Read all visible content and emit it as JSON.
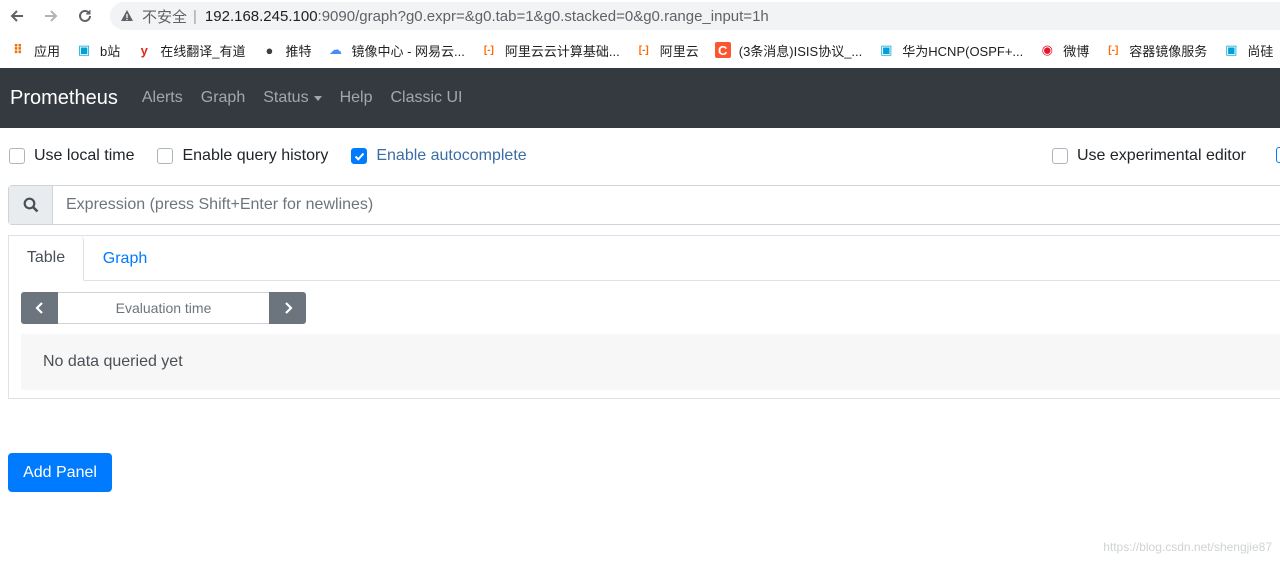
{
  "browser": {
    "insecure_label": "不安全",
    "separator": "|",
    "url_host": "192.168.245.100",
    "url_rest": ":9090/graph?g0.expr=&g0.tab=1&g0.stacked=0&g0.range_input=1h"
  },
  "bookmarks": [
    {
      "label": "应用",
      "icon": "apps-grid-icon",
      "color": "#e8710a"
    },
    {
      "label": "b站",
      "icon": "bilibili-icon",
      "color": "#00a1d6"
    },
    {
      "label": "在线翻译_有道",
      "icon": "youdao-icon",
      "color": "#e1251b"
    },
    {
      "label": "推特",
      "icon": "globe-icon",
      "color": "#3c4043"
    },
    {
      "label": "镜像中心 - 网易云...",
      "icon": "cloud-icon",
      "color": "#4c8bf5"
    },
    {
      "label": "阿里云云计算基础...",
      "icon": "aliyun-icon",
      "color": "#ff6a00"
    },
    {
      "label": "阿里云",
      "icon": "aliyun-icon",
      "color": "#ff6a00"
    },
    {
      "label": "(3条消息)ISIS协议_...",
      "icon": "csdn-icon",
      "color": "#fc5531"
    },
    {
      "label": "华为HCNP(OSPF+...",
      "icon": "bilibili-icon",
      "color": "#00a1d6"
    },
    {
      "label": "微博",
      "icon": "weibo-icon",
      "color": "#e6162d"
    },
    {
      "label": "容器镜像服务",
      "icon": "aliyun-icon",
      "color": "#ff6a00"
    },
    {
      "label": "尚硅",
      "icon": "bilibili-icon",
      "color": "#00a1d6"
    }
  ],
  "navbar": {
    "brand": "Prometheus",
    "links": {
      "alerts": "Alerts",
      "graph": "Graph",
      "status": "Status",
      "help": "Help",
      "classic": "Classic UI"
    }
  },
  "options": {
    "local_time": {
      "label": "Use local time",
      "checked": false
    },
    "query_history": {
      "label": "Enable query history",
      "checked": false
    },
    "autocomplete": {
      "label": "Enable autocomplete",
      "checked": true
    },
    "experimental_editor": {
      "label": "Use experimental editor",
      "checked": false
    }
  },
  "expression": {
    "placeholder": "Expression (press Shift+Enter for newlines)"
  },
  "panel": {
    "tabs": {
      "table": "Table",
      "graph": "Graph"
    },
    "eval_placeholder": "Evaluation time",
    "no_data": "No data queried yet"
  },
  "add_panel": "Add Panel",
  "watermark": "https://blog.csdn.net/shengjie87",
  "colors": {
    "accent": "#007bff",
    "navbar": "#343a40",
    "secondary": "#6c757d"
  }
}
